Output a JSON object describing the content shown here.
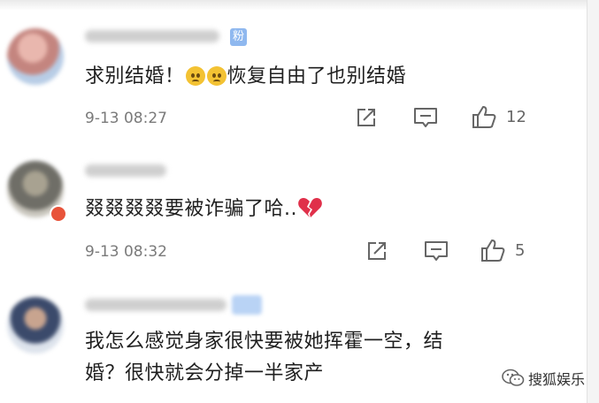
{
  "comments": [
    {
      "text_parts": [
        "求别结婚！",
        "恢复自由了也别结婚"
      ],
      "emojis": [
        "worried-face-emoji",
        "worried-face-emoji"
      ],
      "badge": "粉",
      "time": "9-13 08:27",
      "likes": "12"
    },
    {
      "text": "叕叕叕叕要被诈骗了哈..",
      "emoji": "broken-heart-emoji",
      "time": "9-13 08:32",
      "likes": "5"
    },
    {
      "line1": "我怎么感觉身家很快要被她挥霍一空，结",
      "line2": "婚？很快就会分掉一半家产"
    }
  ],
  "watermark": "搜狐娱乐",
  "icons": {
    "share": "share-icon",
    "comment": "comment-icon",
    "like": "thumbs-up-icon",
    "watermark": "wechat-logo-icon"
  },
  "colors": {
    "text": "#1f1f1f",
    "time": "#7a7a7a",
    "badge": "#8fb8ef",
    "broken_heart": "#e0304a"
  }
}
